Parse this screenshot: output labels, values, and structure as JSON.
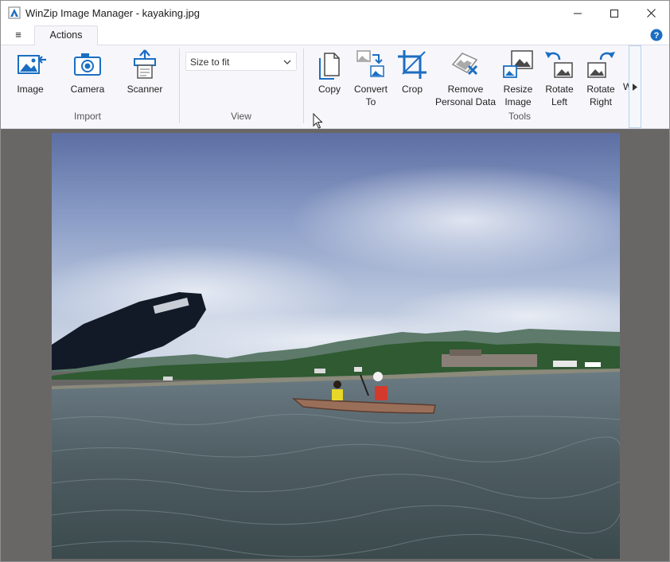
{
  "window": {
    "title": "WinZip Image Manager - kayaking.jpg"
  },
  "titlebar": {
    "minimize_icon": "minimize-icon",
    "maximize_icon": "maximize-icon",
    "close_icon": "close-icon"
  },
  "menu": {
    "hamburger": "≡",
    "tab": "Actions"
  },
  "ribbon": {
    "import": {
      "group_label": "Import",
      "image": "Image",
      "camera": "Camera",
      "scanner": "Scanner"
    },
    "view": {
      "group_label": "View",
      "size_value": "Size to fit"
    },
    "tools": {
      "group_label": "Tools",
      "copy": "Copy",
      "convert_1": "Convert",
      "convert_2": "To",
      "crop": "Crop",
      "remove_1": "Remove",
      "remove_2": "Personal Data",
      "resize_1": "Resize",
      "resize_2": "Image",
      "rotate_left_1": "Rotate",
      "rotate_left_2": "Left",
      "rotate_right_1": "Rotate",
      "rotate_right_2": "Right",
      "overflow": "W"
    }
  },
  "colors": {
    "accent": "#1b6ec2",
    "canvas_bg": "#696766",
    "ribbon_bg": "#f7f7fb"
  }
}
